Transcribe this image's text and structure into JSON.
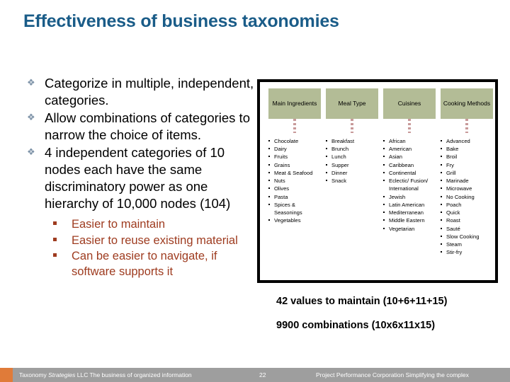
{
  "slide": {
    "title": "Effectiveness of business taxonomies"
  },
  "bullets": {
    "marker_glyph": "❖",
    "level1": [
      "Categorize in multiple, independent, categories.",
      "Allow combinations of categories to narrow the choice of items.",
      "4 independent categories of 10 nodes each have the same discriminatory power as one hierarchy of 10,000 nodes (104)"
    ],
    "level2": [
      "Easier to maintain",
      "Easier to reuse existing material",
      "Can be easier to navigate, if software supports it"
    ]
  },
  "diagram": {
    "facets": [
      {
        "header": "Main Ingredients",
        "items": [
          "Chocolate",
          "Dairy",
          "Fruits",
          "Grains",
          "Meat & Seafood",
          "Nuts",
          "Olives",
          "Pasta",
          "Spices & Seasonings",
          "Vegetables"
        ]
      },
      {
        "header": "Meal Type",
        "items": [
          "Breakfast",
          "Brunch",
          "Lunch",
          "Supper",
          "Dinner",
          "Snack"
        ]
      },
      {
        "header": "Cuisines",
        "items": [
          "African",
          "American",
          "Asian",
          "Caribbean",
          "Continental",
          "Eclectic/ Fusion/ International",
          "Jewish",
          "Latin American",
          "Mediterranean",
          "Middle Eastern",
          "Vegetarian"
        ]
      },
      {
        "header": "Cooking Methods",
        "items": [
          "Advanced",
          "Bake",
          "Broil",
          "Fry",
          "Grill",
          "Marinade",
          "Microwave",
          "No Cooking",
          "Poach",
          "Quick",
          "Roast",
          "Sauté",
          "Slow Cooking",
          "Steam",
          "Stir-fry"
        ]
      }
    ]
  },
  "summary": {
    "line1": "42 values to maintain (10+6+11+15)",
    "line2": "9900 combinations (10x6x11x15)"
  },
  "footer": {
    "left_prefix": "Taxonomy ",
    "left_italic": "Strategies",
    "left_suffix": " LLC  The business of organized information",
    "page_number": "22",
    "right": "Project Performance Corporation  Simplifying the complex"
  },
  "colors": {
    "title": "#1a5c88",
    "facet_header_bg": "#b3bc96",
    "connector": "#c89a9a",
    "sub_bullet_text": "#9e3b1f",
    "footer_bar": "#9e9e9e",
    "footer_swatch": "#e07b39"
  }
}
